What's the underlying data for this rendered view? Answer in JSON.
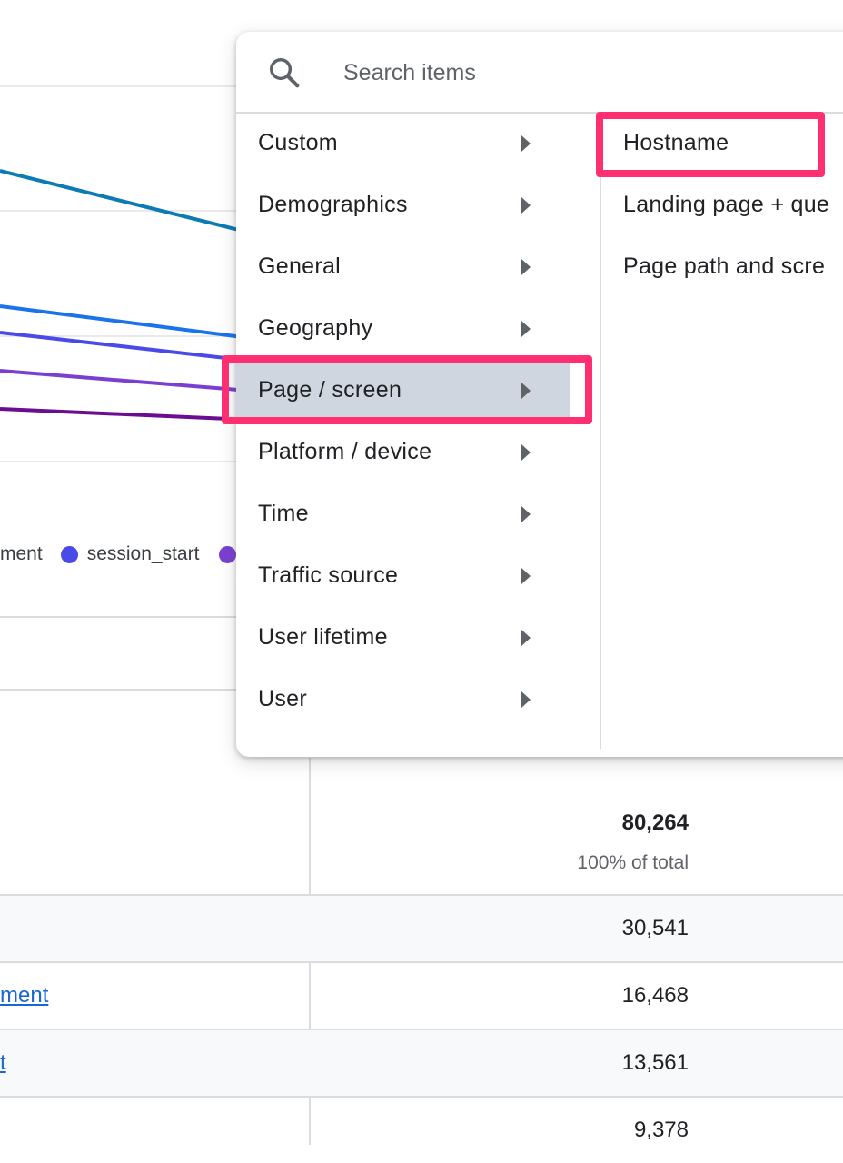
{
  "legend": {
    "items": [
      {
        "label": "ment",
        "color": "#1a73e8",
        "show_dot": false
      },
      {
        "label": "session_start",
        "color": "#4a4ae8",
        "show_dot": true
      }
    ],
    "trailing_dot_color": "#7a3fd1"
  },
  "series_colors": [
    "#0b7bb5",
    "#1a73e8",
    "#4a4ae8",
    "#7a3fd1",
    "#6a0d91"
  ],
  "menu": {
    "search_placeholder": "Search items",
    "categories": [
      {
        "label": "Custom",
        "selected": false
      },
      {
        "label": "Demographics",
        "selected": false
      },
      {
        "label": "General",
        "selected": false
      },
      {
        "label": "Geography",
        "selected": false
      },
      {
        "label": "Page / screen",
        "selected": true
      },
      {
        "label": "Platform / device",
        "selected": false
      },
      {
        "label": "Time",
        "selected": false
      },
      {
        "label": "Traffic source",
        "selected": false
      },
      {
        "label": "User lifetime",
        "selected": false
      },
      {
        "label": "User",
        "selected": false
      }
    ],
    "subitems": [
      {
        "label": "Hostname"
      },
      {
        "label": "Landing page + que"
      },
      {
        "label": "Page path and scre"
      }
    ]
  },
  "table": {
    "total_value": "80,264",
    "total_sub": "100% of total",
    "rows": [
      {
        "label": "",
        "value": "30,541"
      },
      {
        "label": "ment",
        "value": "16,468"
      },
      {
        "label": "t",
        "value": "13,561"
      },
      {
        "label": "",
        "value": "9,378"
      }
    ]
  },
  "highlight_color": "#ff2f72"
}
